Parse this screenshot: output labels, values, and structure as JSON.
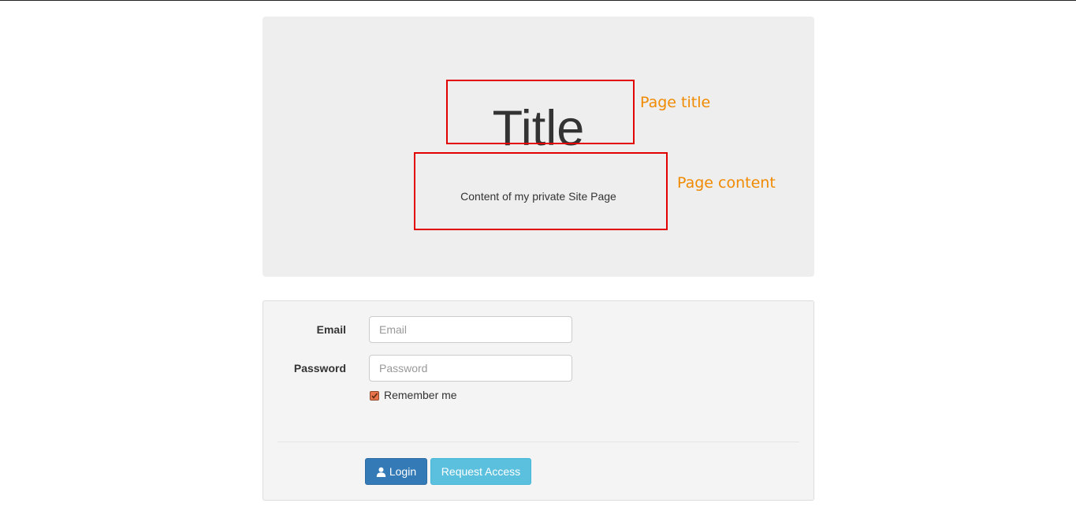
{
  "jumbotron": {
    "title": "Title",
    "content": "Content of my private Site Page"
  },
  "annotations": {
    "title_label": "Page title",
    "content_label": "Page content",
    "box_color": "#e00000",
    "label_color": "#f08a00"
  },
  "login_form": {
    "email_label": "Email",
    "email_placeholder": "Email",
    "email_value": "",
    "password_label": "Password",
    "password_placeholder": "Password",
    "password_value": "",
    "remember_label": "Remember me",
    "remember_checked": true,
    "login_button": "Login",
    "login_icon": "user-icon",
    "request_button": "Request Access"
  },
  "colors": {
    "primary": "#337ab7",
    "info": "#5bc0de"
  }
}
